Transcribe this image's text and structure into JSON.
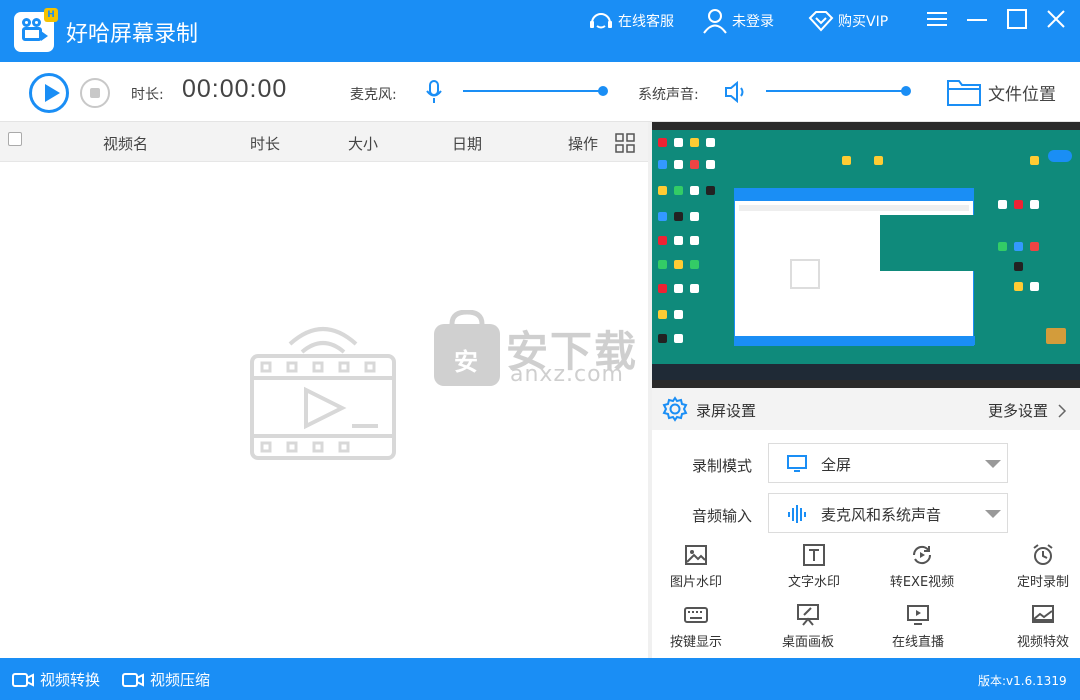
{
  "app": {
    "title": "好哈屏幕录制",
    "logo_badge": "H",
    "accent": "#1a8ef5"
  },
  "titlebar": {
    "support_label": "在线客服",
    "login_label": "未登录",
    "vip_label": "购买VIP"
  },
  "toolbar": {
    "duration_label": "时长:",
    "duration_value": "00:00:00",
    "mic_label": "麦克风:",
    "system_audio_label": "系统声音:",
    "mic_level": 1.0,
    "system_audio_level": 1.0,
    "folder_label": "文件位置"
  },
  "table": {
    "columns": [
      "视频名",
      "时长",
      "大小",
      "日期",
      "操作"
    ],
    "rows": []
  },
  "settings": {
    "title": "录屏设置",
    "more_label": "更多设置",
    "record_mode_label": "录制模式",
    "record_mode_value": "全屏",
    "audio_input_label": "音频输入",
    "audio_input_value": "麦克风和系统声音"
  },
  "tools": [
    {
      "label": "图片水印",
      "icon": "image-watermark-icon"
    },
    {
      "label": "文字水印",
      "icon": "text-watermark-icon"
    },
    {
      "label": "转EXE视频",
      "icon": "convert-exe-icon"
    },
    {
      "label": "定时录制",
      "icon": "alarm-clock-icon"
    },
    {
      "label": "按键显示",
      "icon": "keyboard-icon"
    },
    {
      "label": "桌面画板",
      "icon": "drawing-board-icon"
    },
    {
      "label": "在线直播",
      "icon": "live-stream-icon"
    },
    {
      "label": "视频特效",
      "icon": "video-effect-icon"
    }
  ],
  "bottombar": {
    "convert_label": "视频转换",
    "compress_label": "视频压缩",
    "version": "版本:v1.6.1319"
  },
  "watermark": {
    "logo_char": "安",
    "text": "安下载",
    "sub": "anxz.com"
  }
}
